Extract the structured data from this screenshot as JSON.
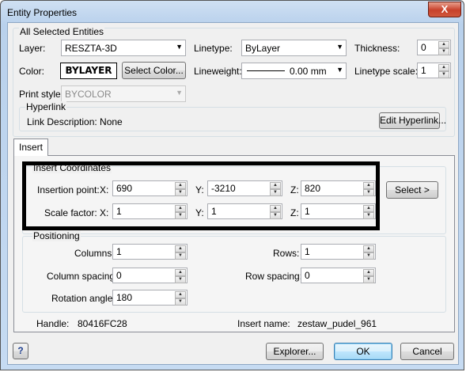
{
  "window": {
    "title": "Entity Properties",
    "close_glyph": "X"
  },
  "all": {
    "group_label": "All Selected Entities",
    "layer_label": "Layer:",
    "layer_value": "RESZTA-3D",
    "linetype_label": "Linetype:",
    "linetype_value": "ByLayer",
    "thickness_label": "Thickness:",
    "thickness_value": "0",
    "color_label": "Color:",
    "color_value": "BYLAYER",
    "select_color_label": "Select Color...",
    "lineweight_label": "Lineweight:",
    "lineweight_value": "0.00 mm",
    "linetype_scale_label": "Linetype scale:",
    "linetype_scale_value": "1",
    "print_style_label": "Print style:",
    "print_style_value": "BYCOLOR",
    "hyperlink_label": "Hyperlink",
    "link_description": "Link Description: None",
    "edit_hyperlink_label": "Edit Hyperlink..."
  },
  "tabs": [
    {
      "label": "Insert"
    }
  ],
  "insert": {
    "coords_label": "Insert Coordinates",
    "insertion_point_label": "Insertion point:",
    "scale_factor_label": "Scale factor:",
    "x_label": "X:",
    "y_label": "Y:",
    "z_label": "Z:",
    "ins_x": "690",
    "ins_y": "-3210",
    "ins_z": "820",
    "sc_x": "1",
    "sc_y": "1",
    "sc_z": "1",
    "select_label": "Select >",
    "positioning_label": "Positioning",
    "columns_label": "Columns:",
    "columns_value": "1",
    "rows_label": "Rows:",
    "rows_value": "1",
    "column_spacing_label": "Column spacing:",
    "column_spacing_value": "0",
    "row_spacing_label": "Row spacing:",
    "row_spacing_value": "0",
    "rotation_label": "Rotation angle:",
    "rotation_value": "180",
    "handle_label": "Handle:",
    "handle_value": "80416FC28",
    "insert_name_label": "Insert name:",
    "insert_name_value": "zestaw_pudel_961"
  },
  "footer": {
    "help_label": "?",
    "explorer_label": "Explorer...",
    "ok_label": "OK",
    "cancel_label": "Cancel"
  }
}
